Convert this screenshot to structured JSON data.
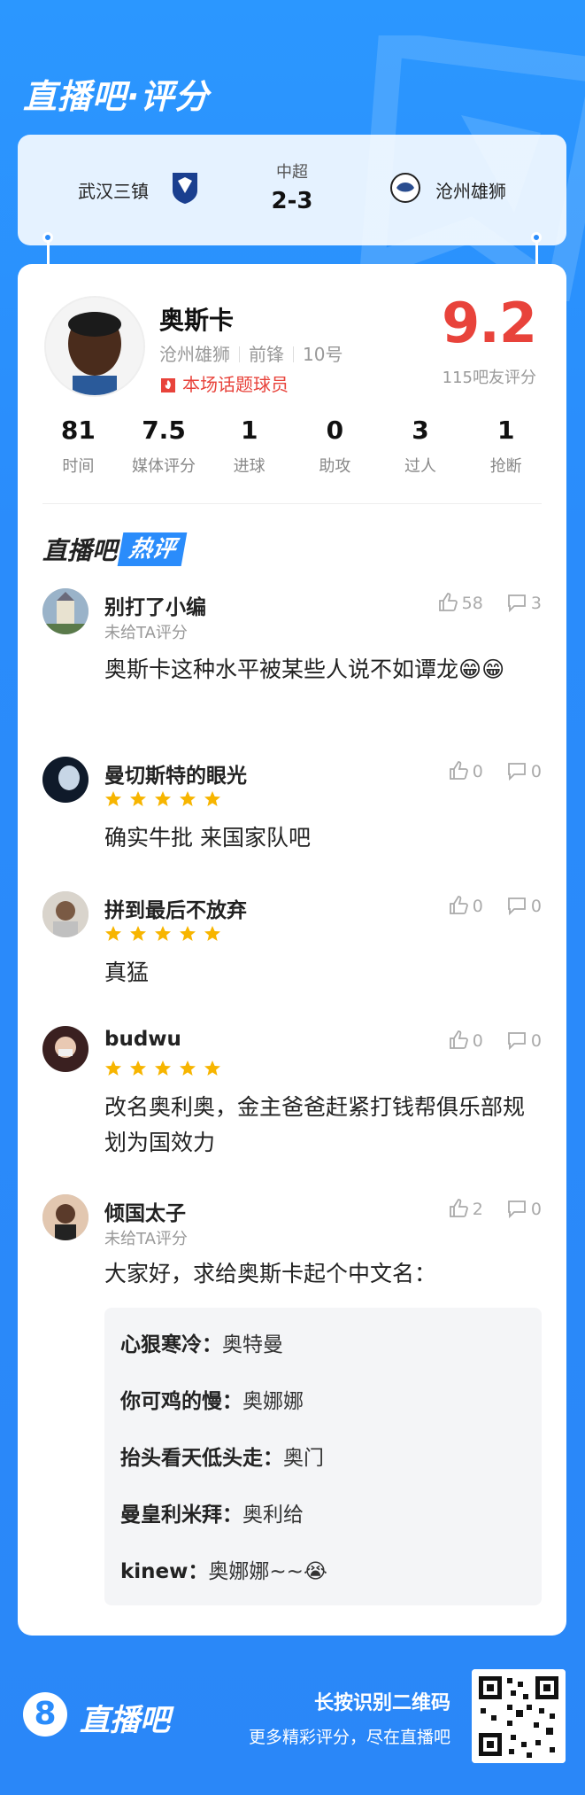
{
  "header": {
    "title": "直播吧·评分"
  },
  "match": {
    "home_team": "武汉三镇",
    "away_team": "沧州雄狮",
    "league": "中超",
    "score": "2-3"
  },
  "player": {
    "name": "奥斯卡",
    "team": "沧州雄狮",
    "position": "前锋",
    "number": "10号",
    "hot_label": "本场话题球员",
    "rating": "9.2",
    "rating_count": "115吧友评分",
    "stats": [
      {
        "value": "81",
        "label": "时间"
      },
      {
        "value": "7.5",
        "label": "媒体评分"
      },
      {
        "value": "1",
        "label": "进球"
      },
      {
        "value": "0",
        "label": "助攻"
      },
      {
        "value": "3",
        "label": "过人"
      },
      {
        "value": "1",
        "label": "抢断"
      }
    ]
  },
  "hot_comments": {
    "title_a": "直播吧",
    "title_b": "热评",
    "items": [
      {
        "name": "别打了小编",
        "sub": "未给TA评分",
        "stars": 0,
        "text": "奥斯卡这种水平被某些人说不如谭龙😁😁",
        "likes": "58",
        "dislikes": "3"
      },
      {
        "name": "曼切斯特的眼光",
        "sub": "",
        "stars": 5,
        "text": "确实牛批 来国家队吧",
        "likes": "0",
        "dislikes": "0"
      },
      {
        "name": "拼到最后不放弃",
        "sub": "",
        "stars": 5,
        "text": "真猛",
        "likes": "0",
        "dislikes": "0"
      },
      {
        "name": "budwu",
        "sub": "",
        "stars": 5,
        "text": "改名奥利奥，金主爸爸赶紧打钱帮俱乐部规划为国效力",
        "likes": "0",
        "dislikes": "0"
      },
      {
        "name": "倾国太子",
        "sub": "未给TA评分",
        "stars": 0,
        "text": "大家好，求给奥斯卡起个中文名：",
        "likes": "2",
        "dislikes": "0"
      }
    ],
    "quoted": [
      {
        "who": "心狠寒冷：",
        "what": "奥特曼"
      },
      {
        "who": "你可鸡的慢：",
        "what": "奥娜娜"
      },
      {
        "who": "抬头看天低头走：",
        "what": "奥门"
      },
      {
        "who": "曼皇利米拜：",
        "what": "奥利给"
      },
      {
        "who": "kinew：",
        "what": "奥娜娜~~😭"
      }
    ]
  },
  "footer": {
    "brand": "直播吧",
    "logo_glyph": "8",
    "cta": "长按识别二维码",
    "sub": "更多精彩评分，尽在直播吧"
  },
  "colors": {
    "accent": "#2a8cfb",
    "rating": "#e8433b",
    "star": "#f7b500"
  }
}
